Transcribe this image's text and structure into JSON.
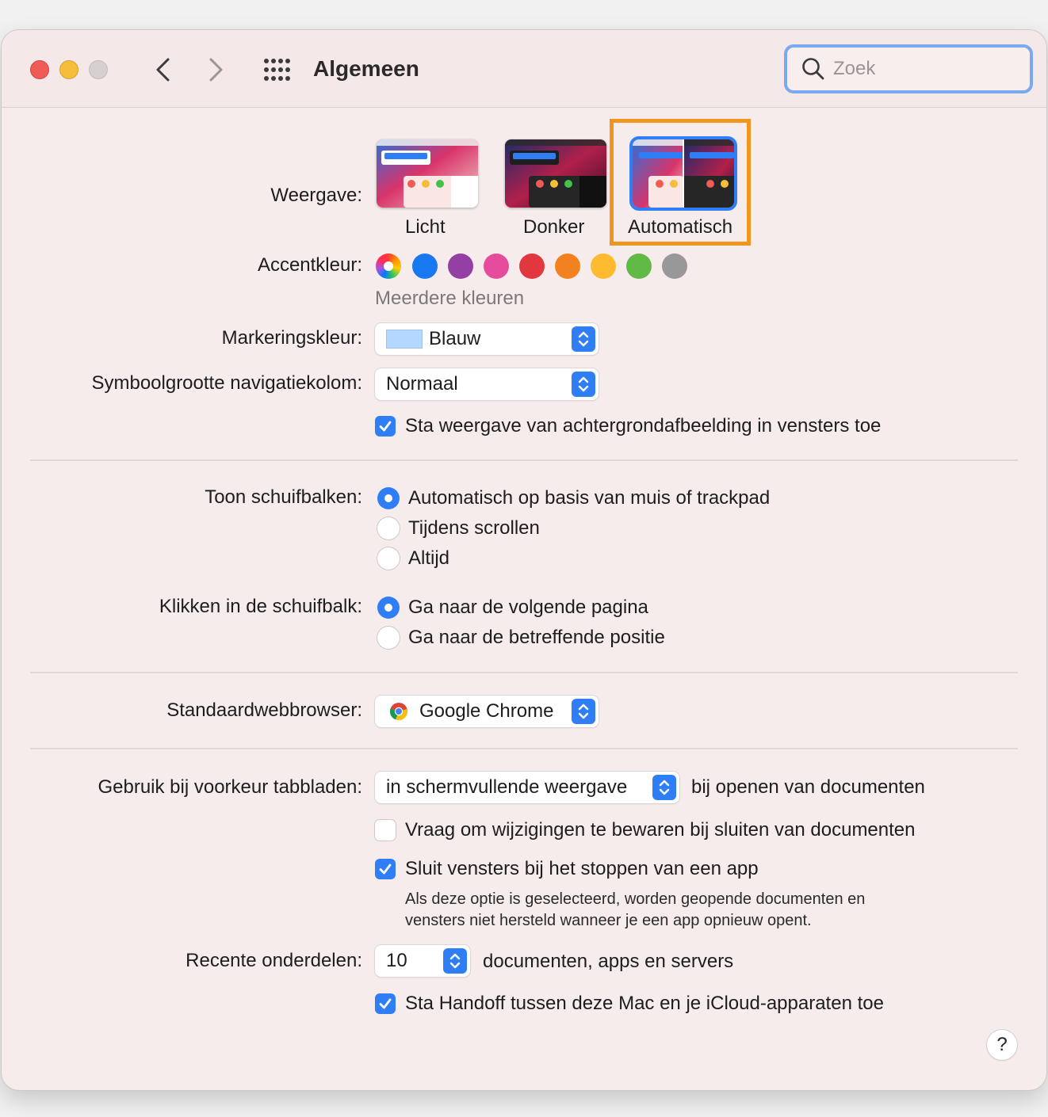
{
  "window": {
    "title": "Algemeen",
    "search_placeholder": "Zoek"
  },
  "appearance": {
    "label": "Weergave:",
    "options": [
      {
        "name": "Licht",
        "selected": false
      },
      {
        "name": "Donker",
        "selected": false
      },
      {
        "name": "Automatisch",
        "selected": true
      }
    ]
  },
  "accent": {
    "label": "Accentkleur:",
    "caption": "Meerdere kleuren",
    "colors": [
      "multicolor",
      "#1778f2",
      "#933fa3",
      "#e54d9c",
      "#e0383e",
      "#f48120",
      "#fdbb2f",
      "#62ba46",
      "#989898"
    ],
    "selected": "multicolor"
  },
  "highlight": {
    "label": "Markeringskleur:",
    "value": "Blauw",
    "swatch_color": "#b3d7ff"
  },
  "sidebar_icon_size": {
    "label": "Symboolgrootte navigatiekolom:",
    "value": "Normaal"
  },
  "wallpaper_tinting": {
    "label": "Sta weergave van achtergrondafbeelding in vensters toe",
    "checked": true
  },
  "scrollbars": {
    "label": "Toon schuifbalken:",
    "options": [
      {
        "label": "Automatisch op basis van muis of trackpad",
        "selected": true
      },
      {
        "label": "Tijdens scrollen",
        "selected": false
      },
      {
        "label": "Altijd",
        "selected": false
      }
    ]
  },
  "scrollbar_click": {
    "label": "Klikken in de schuifbalk:",
    "options": [
      {
        "label": "Ga naar de volgende pagina",
        "selected": true
      },
      {
        "label": "Ga naar de betreffende positie",
        "selected": false
      }
    ]
  },
  "browser": {
    "label": "Standaardwebbrowser:",
    "value": "Google Chrome"
  },
  "tabs": {
    "label": "Gebruik bij voorkeur tabbladen:",
    "value": "in schermvullende weergave",
    "suffix": "bij openen van documenten"
  },
  "ask_keep_changes": {
    "label": "Vraag om wijzigingen te bewaren bij sluiten van documenten",
    "checked": false
  },
  "close_windows": {
    "label": "Sluit vensters bij het stoppen van een app",
    "checked": true,
    "description_line1": "Als deze optie is geselecteerd, worden geopende documenten en",
    "description_line2": "vensters niet hersteld wanneer je een app opnieuw opent."
  },
  "recent_items": {
    "label": "Recente onderdelen:",
    "value": "10",
    "suffix": "documenten, apps en servers"
  },
  "handoff": {
    "label": "Sta Handoff tussen deze Mac en je iCloud-apparaten toe",
    "checked": true
  },
  "help_label": "?"
}
